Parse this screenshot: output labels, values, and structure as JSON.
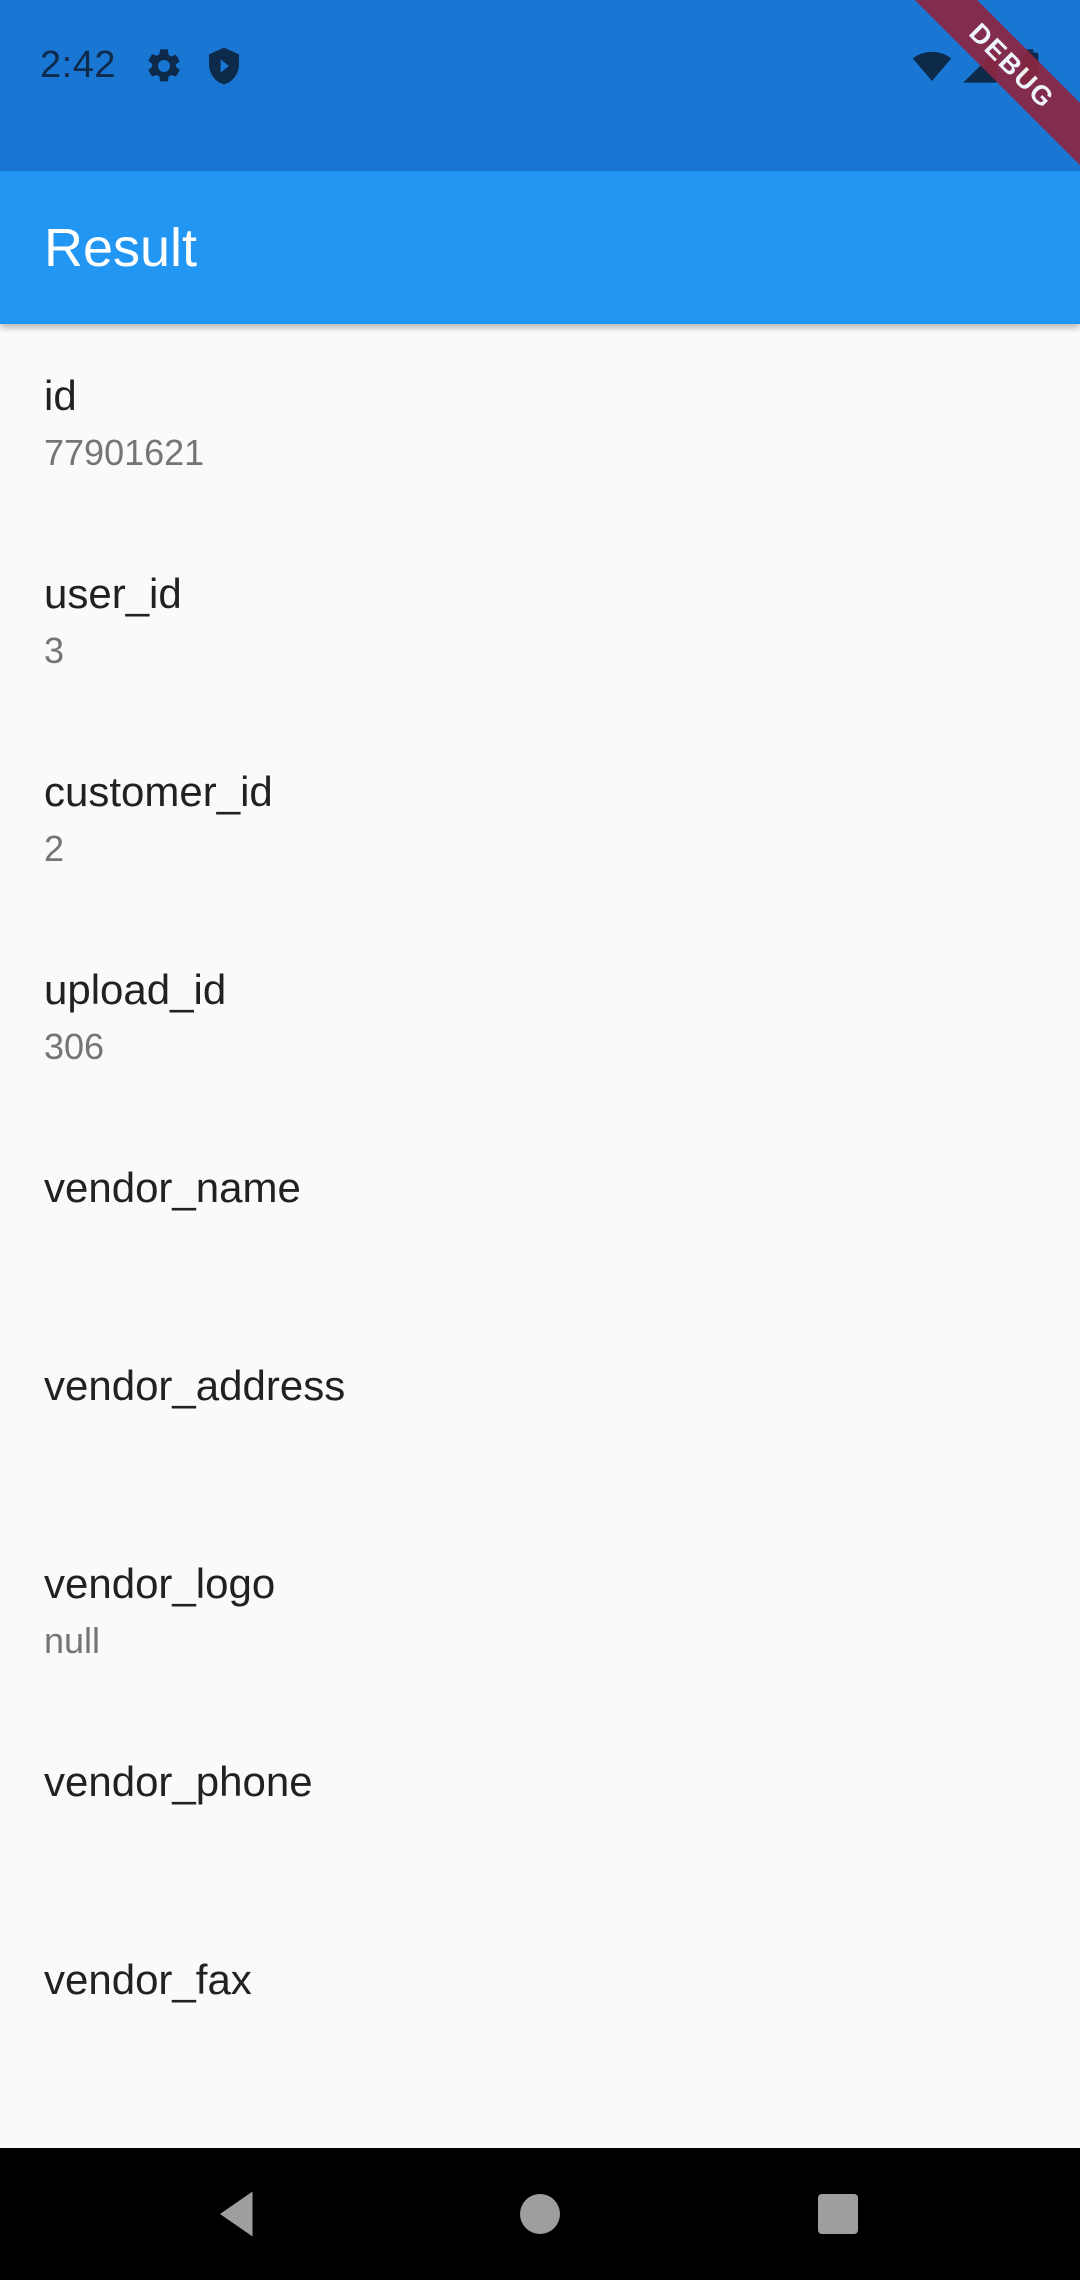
{
  "status_bar": {
    "time": "2:42",
    "icons": [
      "gear-icon",
      "shield-icon",
      "wifi-icon",
      "signal-icon",
      "battery-icon"
    ],
    "debug_label": "DEBUG"
  },
  "app_bar": {
    "title": "Result"
  },
  "fields": [
    {
      "label": "id",
      "value": "77901621"
    },
    {
      "label": "user_id",
      "value": "3"
    },
    {
      "label": "customer_id",
      "value": "2"
    },
    {
      "label": "upload_id",
      "value": "306"
    },
    {
      "label": "vendor_name",
      "value": ""
    },
    {
      "label": "vendor_address",
      "value": ""
    },
    {
      "label": "vendor_logo",
      "value": "null"
    },
    {
      "label": "vendor_phone",
      "value": ""
    },
    {
      "label": "vendor_fax",
      "value": ""
    }
  ],
  "nav_bar": {
    "buttons": [
      "back-icon",
      "home-icon",
      "recents-icon"
    ]
  },
  "colors": {
    "status_bar": "#1976d2",
    "app_bar": "#2196f3",
    "background": "#fafafa",
    "title_text": "#212121",
    "value_text": "#757575",
    "debug_ribbon": "#8b2742"
  }
}
